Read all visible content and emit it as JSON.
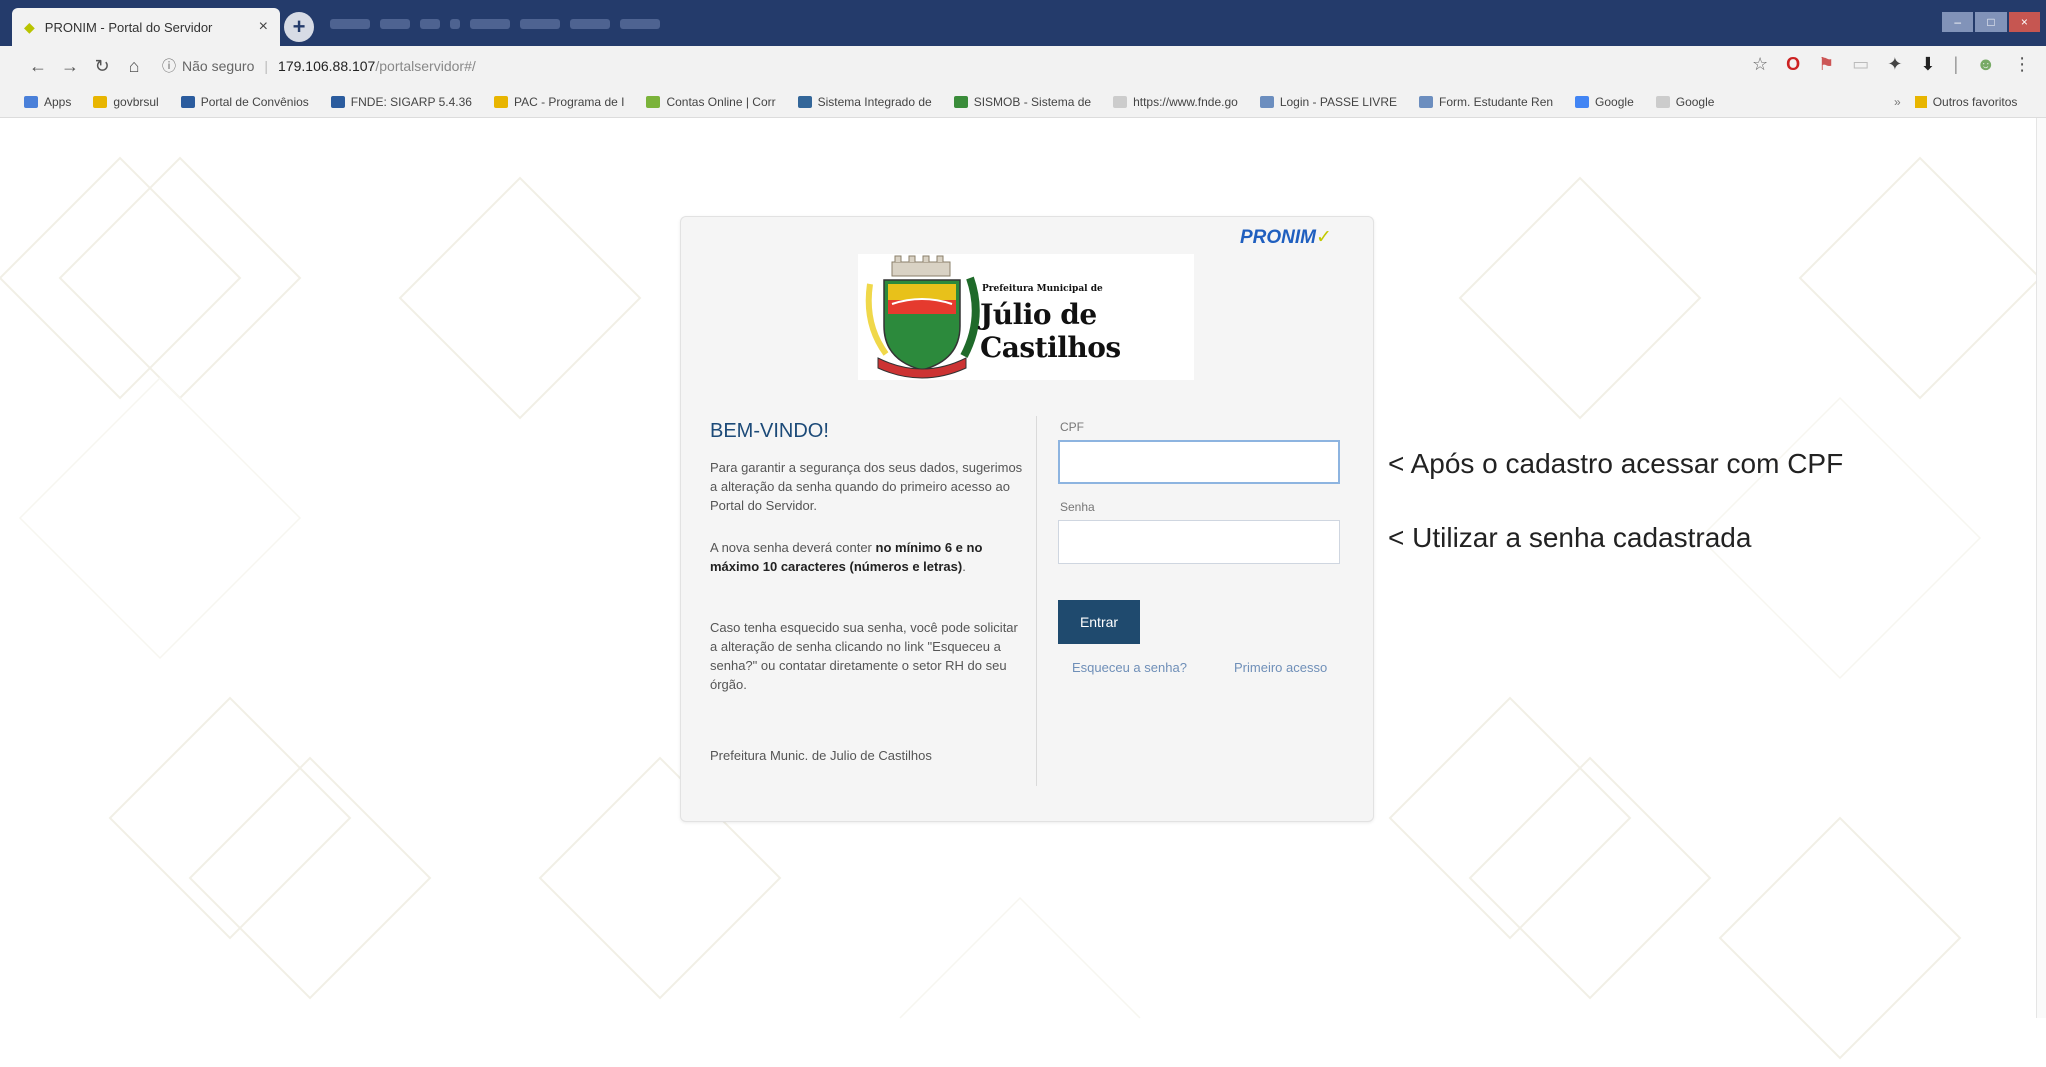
{
  "browser": {
    "tab_title": "PRONIM - Portal do Servidor",
    "tab_close": "×",
    "new_tab": "+",
    "security_label": "Não seguro",
    "url_host": "179.106.88.107",
    "url_path": "/portalservidor#/",
    "bookmarks": [
      {
        "label": "Apps",
        "color": "#4a80d9"
      },
      {
        "label": "govbrsul",
        "color": "#e8b500"
      },
      {
        "label": "Portal de Convênios",
        "color": "#2b5c9e"
      },
      {
        "label": "FNDE: SIGARP 5.4.36",
        "color": "#2b5c9e"
      },
      {
        "label": "PAC - Programa de I",
        "color": "#e8b500"
      },
      {
        "label": "Contas Online | Corr",
        "color": "#7bb33a"
      },
      {
        "label": "Sistema Integrado de",
        "color": "#336699"
      },
      {
        "label": "SISMOB - Sistema de",
        "color": "#3a8c3a"
      },
      {
        "label": "https://www.fnde.go",
        "color": "#cccccc"
      },
      {
        "label": "Login - PASSE LIVRE",
        "color": "#6c8ebf"
      },
      {
        "label": "Form. Estudante Ren",
        "color": "#6c8ebf"
      },
      {
        "label": "Google",
        "color": "#4285f4"
      },
      {
        "label": "Google",
        "color": "#cccccc"
      }
    ],
    "bookmarks_more": "»",
    "other_bookmarks": "Outros favoritos"
  },
  "login": {
    "brand": "PRONIM",
    "logo_prefix": "Prefeitura Municipal de",
    "logo_city": "Júlio de Castilhos",
    "welcome_title": "BEM-VINDO!",
    "para1": "Para garantir a segurança dos seus dados, sugerimos a alteração da senha quando do primeiro acesso ao Portal do Servidor.",
    "para2_pre": "A nova senha deverá conter ",
    "para2_bold": "no mínimo 6 e no máximo 10 caracteres (números e letras)",
    "para2_post": ".",
    "para3": "Caso tenha esquecido sua senha, você pode solicitar a alteração de senha clicando no link \"Esqueceu a senha?\" ou contatar diretamente o setor RH do seu órgão.",
    "footer": "Prefeitura Munic. de Julio de Castilhos",
    "cpf_label": "CPF",
    "cpf_value": "",
    "senha_label": "Senha",
    "senha_value": "",
    "submit_label": "Entrar",
    "forgot_link": "Esqueceu a senha?",
    "first_access_link": "Primeiro acesso"
  },
  "annotations": {
    "cpf_note": "< Após o cadastro acessar com CPF",
    "senha_note": "< Utilizar a senha cadastrada"
  },
  "colors": {
    "tabbar": "#243b6b",
    "brand_blue": "#1f5fbf",
    "brand_accent": "#c2c900",
    "button": "#1f4a6e",
    "title_blue": "#1c4a78"
  }
}
